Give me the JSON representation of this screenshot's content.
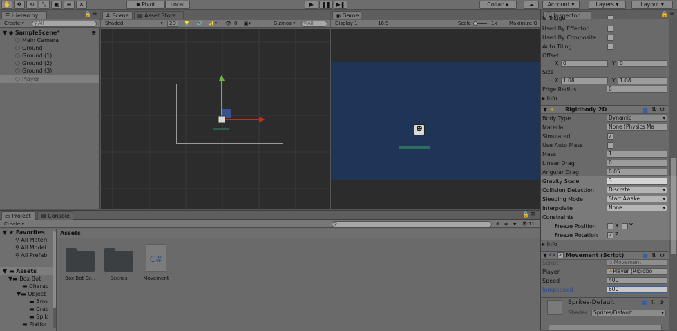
{
  "toolbar": {
    "pivot": "Pivot",
    "local": "Local",
    "collab": "Collab ▸",
    "account": "Account ▾",
    "layers": "Layers ▾",
    "layout": "Layout ▾"
  },
  "hierarchy": {
    "tab": "Hierarchy",
    "create": "Create ▾",
    "search": "All",
    "scene": "SampleScene*",
    "items": [
      "Main Camera",
      "Ground",
      "Ground (1)",
      "Ground (2)",
      "Ground (3)",
      "Player"
    ]
  },
  "scene": {
    "tab": "Scene",
    "tab2": "Asset Store",
    "shaded": "Shaded",
    "mode2d": "2D",
    "gizmos": "Gizmos ▾",
    "search": "All",
    "count": "0"
  },
  "game": {
    "tab": "Game",
    "display": "Display 1",
    "aspect": "16:9",
    "scale_label": "Scale",
    "scale_val": "1x",
    "maximize": "Maximize O"
  },
  "project": {
    "tab": "Project",
    "tab2": "Console",
    "create": "Create ▾",
    "breadcrumb": "Assets",
    "count": "11",
    "favorites": "Favorites",
    "fav_items": [
      "All Materi",
      "All Model",
      "All Prefab"
    ],
    "assets_root": "Assets",
    "tree": [
      "Box Bot",
      "Charac",
      "Object",
      "Arro",
      "Crat",
      "Spik",
      "Platfor"
    ],
    "assets": [
      {
        "label": "Box Bot Gr..."
      },
      {
        "label": "Scenes"
      },
      {
        "label": "Movement",
        "glyph": "C#"
      }
    ]
  },
  "inspector": {
    "tab": "Inspector",
    "top": [
      {
        "label": "Is Trigger"
      },
      {
        "label": "Used By Effector"
      },
      {
        "label": "Used By Composite"
      },
      {
        "label": "Auto Tiling"
      }
    ],
    "offset_label": "Offset",
    "offset_x": "0",
    "offset_y": "0",
    "size_label": "Size",
    "size_x": "1.08",
    "size_y": "1.08",
    "x": "X",
    "y": "Y",
    "edge_radius_label": "Edge Radius",
    "edge_radius": "0",
    "info": "Info",
    "rb": {
      "title": "Rigidbody 2D",
      "body_type_label": "Body Type",
      "body_type": "Dynamic",
      "material_label": "Material",
      "material": "None (Physics Ma",
      "simulated_label": "Simulated",
      "auto_mass_label": "Use Auto Mass",
      "mass_label": "Mass",
      "mass": "1",
      "linear_drag_label": "Linear Drag",
      "linear_drag": "0",
      "angular_drag_label": "Angular Drag",
      "angular_drag": "0.05",
      "gravity_label": "Gravity Scale",
      "gravity": "3",
      "collision_label": "Collision Detection",
      "collision": "Discrete",
      "sleeping_label": "Sleeping Mode",
      "sleeping": "Start Awake",
      "interpolate_label": "Interpolate",
      "interpolate": "None",
      "constraints_label": "Constraints",
      "freeze_pos_label": "Freeze Position",
      "freeze_rot_label": "Freeze Rotation",
      "z": "Z"
    },
    "movement": {
      "title": "Movement (Script)",
      "script_label": "Script",
      "script": "Movement",
      "player_label": "Player",
      "player": "Player (Rigidbo",
      "speed_label": "Speed",
      "speed": "400",
      "jump_label": "Jumpspeed",
      "jump": "600"
    },
    "material": {
      "name": "Sprites-Default",
      "shader_label": "Shader",
      "shader": "Sprites/Default"
    }
  },
  "colors": {
    "accent": "#3a5ea0",
    "game_bg": "#1e3557",
    "scene_bg": "#2c2c2c"
  }
}
